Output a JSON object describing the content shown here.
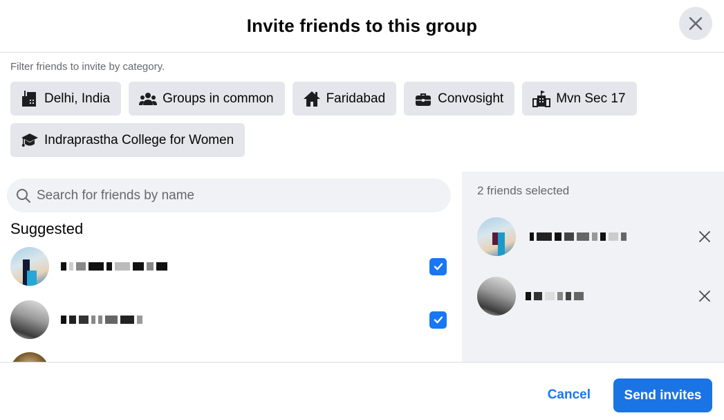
{
  "dialog": {
    "title": "Invite friends to this group",
    "close_icon": "close-icon"
  },
  "filters": {
    "label": "Filter friends to invite by category.",
    "chips": [
      {
        "label": "Delhi, India",
        "icon": "city-icon"
      },
      {
        "label": "Groups in common",
        "icon": "people-group-icon"
      },
      {
        "label": "Faridabad",
        "icon": "home-icon"
      },
      {
        "label": "Convosight",
        "icon": "briefcase-icon"
      },
      {
        "label": "Mvn Sec 17",
        "icon": "school-icon"
      },
      {
        "label": "Indraprastha College for Women",
        "icon": "graduation-cap-icon"
      }
    ]
  },
  "search": {
    "placeholder": "Search for friends by name",
    "value": "",
    "icon": "search-icon"
  },
  "suggested": {
    "title": "Suggested",
    "friends": [
      {
        "name": "[redacted]",
        "checked": true
      },
      {
        "name": "[redacted]",
        "checked": true
      },
      {
        "name": "[redacted]",
        "checked": false
      }
    ]
  },
  "selected": {
    "count_label": "2 friends selected",
    "friends": [
      {
        "name": "[redacted]",
        "remove_icon": "close-icon"
      },
      {
        "name": "[redacted]",
        "remove_icon": "close-icon"
      }
    ]
  },
  "footer": {
    "cancel_label": "Cancel",
    "send_label": "Send invites"
  },
  "colors": {
    "accent": "#1877f2",
    "primary_button": "#1b74e4",
    "chip_bg": "#e4e6eb",
    "panel_bg": "#f0f2f5",
    "secondary_text": "#65676b"
  }
}
